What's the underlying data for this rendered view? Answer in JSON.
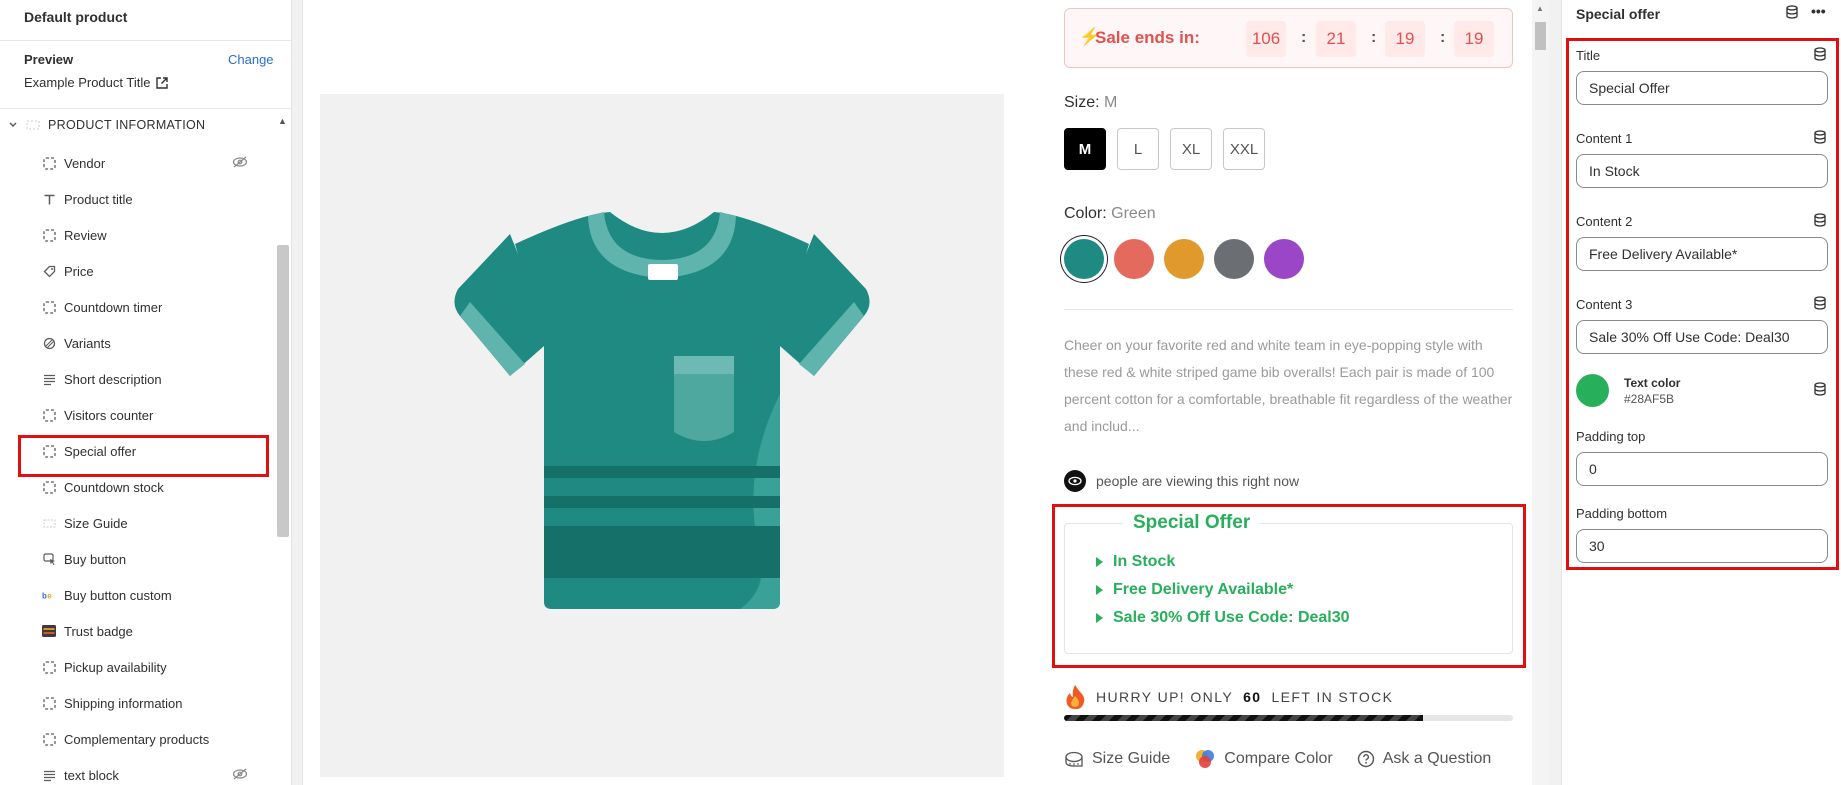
{
  "left": {
    "title": "Default product",
    "preview_label": "Preview",
    "change_label": "Change",
    "preview_product": "Example Product Title",
    "section_title": "PRODUCT INFORMATION",
    "items": [
      {
        "label": "Vendor",
        "icon": "dashed-square-icon",
        "hidden": true
      },
      {
        "label": "Product title",
        "icon": "text-icon"
      },
      {
        "label": "Review",
        "icon": "dashed-square-icon"
      },
      {
        "label": "Price",
        "icon": "price-tag-icon"
      },
      {
        "label": "Countdown timer",
        "icon": "dashed-square-icon"
      },
      {
        "label": "Variants",
        "icon": "variants-icon"
      },
      {
        "label": "Short description",
        "icon": "paragraph-icon"
      },
      {
        "label": "Visitors counter",
        "icon": "dashed-square-icon"
      },
      {
        "label": "Special offer",
        "icon": "dashed-square-icon",
        "selected": true
      },
      {
        "label": "Countdown stock",
        "icon": "dashed-square-icon"
      },
      {
        "label": "Size Guide",
        "icon": "size-guide-icon"
      },
      {
        "label": "Buy button",
        "icon": "cursor-icon"
      },
      {
        "label": "Buy button custom",
        "icon": "be-icon"
      },
      {
        "label": "Trust badge",
        "icon": "trust-badge-icon"
      },
      {
        "label": "Pickup availability",
        "icon": "dashed-square-icon"
      },
      {
        "label": "Shipping information",
        "icon": "dashed-square-icon"
      },
      {
        "label": "Complementary products",
        "icon": "dashed-square-icon"
      },
      {
        "label": "text block",
        "icon": "paragraph-icon",
        "hidden": true
      }
    ]
  },
  "product": {
    "sale_label": "Sale ends in:",
    "timer": [
      "106",
      "21",
      "19",
      "19"
    ],
    "size_label": "Size:",
    "size_value": "M",
    "sizes": [
      "M",
      "L",
      "XL",
      "XXL"
    ],
    "color_label": "Color:",
    "color_value": "Green",
    "swatches": [
      "#1f8a82",
      "#e46a5e",
      "#e09a2c",
      "#6b6f73",
      "#9a46c6"
    ],
    "description": "Cheer on your favorite red and white team in eye-popping style with these red & white striped game bib overalls! Each pair is made of 100 percent cotton for a comfortable, breathable fit regardless of the weather and includ...",
    "viewing_text": "people are viewing this right now",
    "offer": {
      "title": "Special Offer",
      "lines": [
        "In Stock",
        "Free Delivery Available*",
        "Sale 30% Off Use Code: Deal30"
      ]
    },
    "hurry_prefix": "HURRY UP! ONLY",
    "hurry_count": "60",
    "hurry_suffix": "LEFT IN STOCK",
    "stock_progress": 0.8,
    "links": [
      "Size Guide",
      "Compare Color",
      "Ask a Question"
    ]
  },
  "settings": {
    "title": "Special offer",
    "title_label": "Title",
    "title_value": "Special Offer",
    "content1_label": "Content 1",
    "content1_value": "In Stock",
    "content2_label": "Content 2",
    "content2_value": "Free Delivery Available*",
    "content3_label": "Content 3",
    "content3_value": "Sale 30% Off Use Code: Deal30",
    "text_color_label": "Text color",
    "text_color_value": "#28AF5B",
    "padding_top_label": "Padding top",
    "padding_top_value": "0",
    "padding_bottom_label": "Padding bottom",
    "padding_bottom_value": "30"
  },
  "colors": {
    "accent_red": "#e01010",
    "link_blue": "#2c6ecb",
    "timer_red": "#e0524f"
  }
}
